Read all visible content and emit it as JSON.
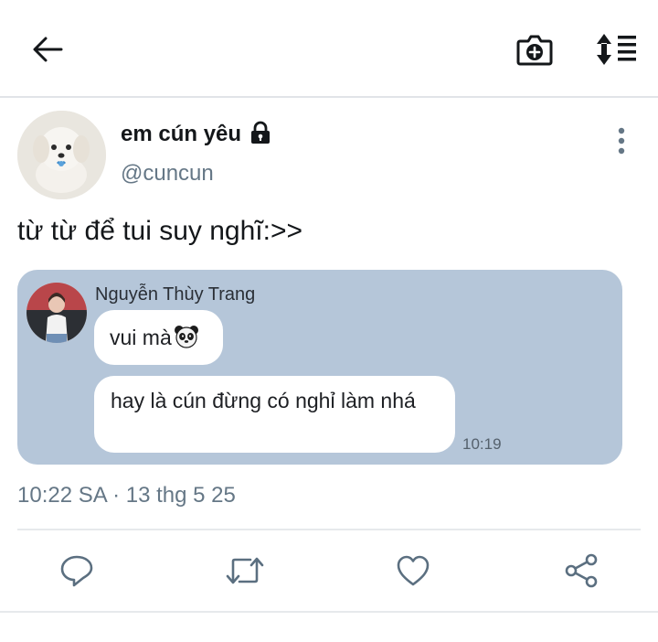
{
  "header": {
    "back_icon": "arrow-left-icon",
    "camera_icon": "camera-plus-icon",
    "sort_icon": "sort-list-icon"
  },
  "tweet": {
    "display_name": "em cún yêu",
    "protected_icon": "lock-icon",
    "handle": "@cuncun",
    "text": "từ từ để tui suy nghĩ:>>",
    "more_icon": "more-vertical-icon",
    "timestamp": "10:22 SA · 13 thg 5 25"
  },
  "media": {
    "background": "#b5c6d9",
    "sender_name": "Nguyễn Thùy Trang",
    "messages": [
      {
        "text": "vui mà",
        "emoji_icon": "panda-icon"
      },
      {
        "text": "hay là cún đừng có nghỉ làm nhá"
      }
    ],
    "message_time": "10:19"
  },
  "actions": {
    "reply_icon": "reply-icon",
    "retweet_icon": "retweet-icon",
    "like_icon": "heart-icon",
    "share_icon": "share-icon",
    "icon_color": "#5b6f80"
  }
}
